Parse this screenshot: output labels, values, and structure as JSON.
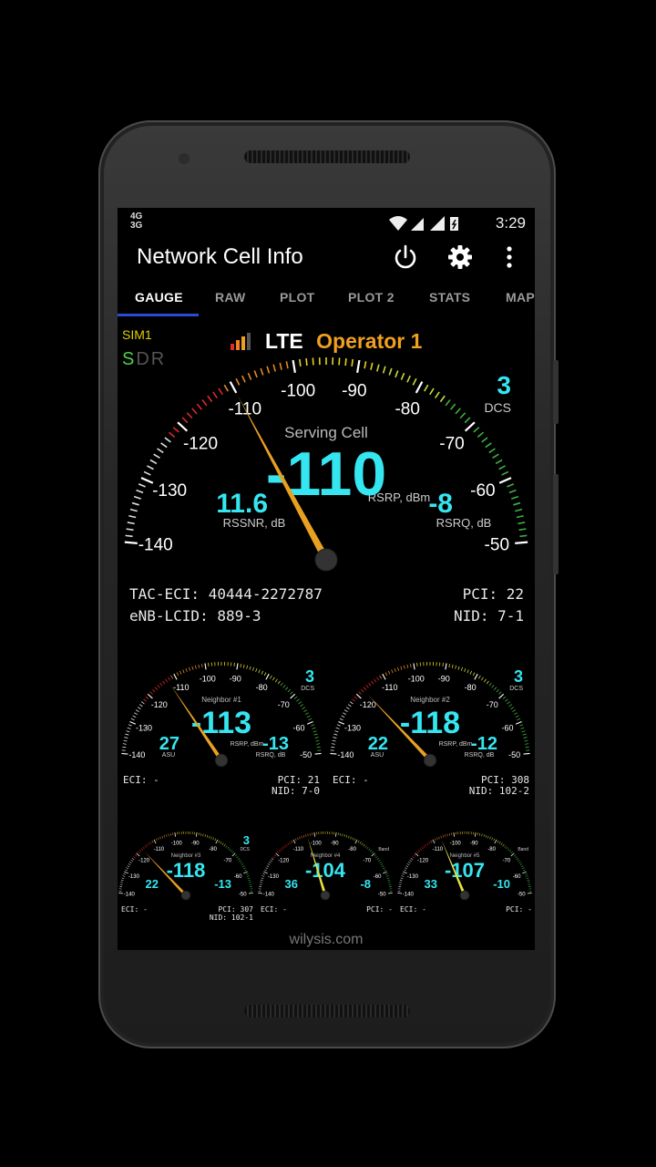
{
  "status_bar": {
    "network": [
      "4G",
      "3G"
    ],
    "time": "3:29"
  },
  "app": {
    "title": "Network Cell Info"
  },
  "tabs": [
    "GAUGE",
    "RAW",
    "PLOT",
    "PLOT 2",
    "STATS",
    "MAP"
  ],
  "sim": {
    "label": "SIM1",
    "sdr": [
      "S",
      "D",
      "R"
    ]
  },
  "operator": {
    "tech": "LTE",
    "name": "Operator 1"
  },
  "main_gauge": {
    "band_value": "3",
    "band_label": "DCS",
    "title": "Serving Cell",
    "value": "-110",
    "value_label": "RSRP, dBm",
    "rssnr": "11.6",
    "rssnr_label": "RSSNR, dB",
    "rsrq": "-8",
    "rsrq_label": "RSRQ, dB",
    "scale": [
      "-140",
      "-130",
      "-120",
      "-110",
      "-100",
      "-90",
      "-80",
      "-70",
      "-60",
      "-50"
    ]
  },
  "main_info": {
    "tac_eci": "TAC-ECI: 40444-2272787",
    "enb": "eNB-LCID: 889-3",
    "pci": "PCI: 22",
    "nid": "NID: 7-1"
  },
  "neighbors": [
    {
      "title": "Neighbor #1",
      "value": "-113",
      "asu": "27",
      "asu_label": "ASU",
      "rsrp_label": "RSRP, dBm",
      "rsrq": "-13",
      "rsrq_label": "RSRQ, dB",
      "band": "3",
      "band_label": "DCS",
      "eci": "ECI: -",
      "pci": "PCI: 21",
      "nid": "NID: 7-0"
    },
    {
      "title": "Neighbor #2",
      "value": "-118",
      "asu": "22",
      "asu_label": "ASU",
      "rsrp_label": "RSRP, dBm",
      "rsrq": "-12",
      "rsrq_label": "RSRQ, dB",
      "band": "3",
      "band_label": "DCS",
      "eci": "ECI: -",
      "pci": "PCI: 308",
      "nid": "NID: 102-2"
    }
  ],
  "mini": [
    {
      "title": "Neighbor #3",
      "value": "-118",
      "asu": "22",
      "rsrq": "-13",
      "band": "3",
      "band_label": "DCS",
      "eci": "ECI: -",
      "pci": "PCI: 307",
      "nid": "NID: 102-1"
    },
    {
      "title": "Neighbor #4",
      "value": "-104",
      "asu": "36",
      "rsrq": "-8",
      "band": "",
      "band_label": "Band",
      "eci": "ECI: -",
      "pci": "PCI: -",
      "nid": ""
    },
    {
      "title": "Neighbor #5",
      "value": "-107",
      "asu": "33",
      "rsrq": "-10",
      "band": "",
      "band_label": "Band",
      "eci": "ECI: -",
      "pci": "PCI: -",
      "nid": ""
    }
  ],
  "footer": "wilysis.com"
}
